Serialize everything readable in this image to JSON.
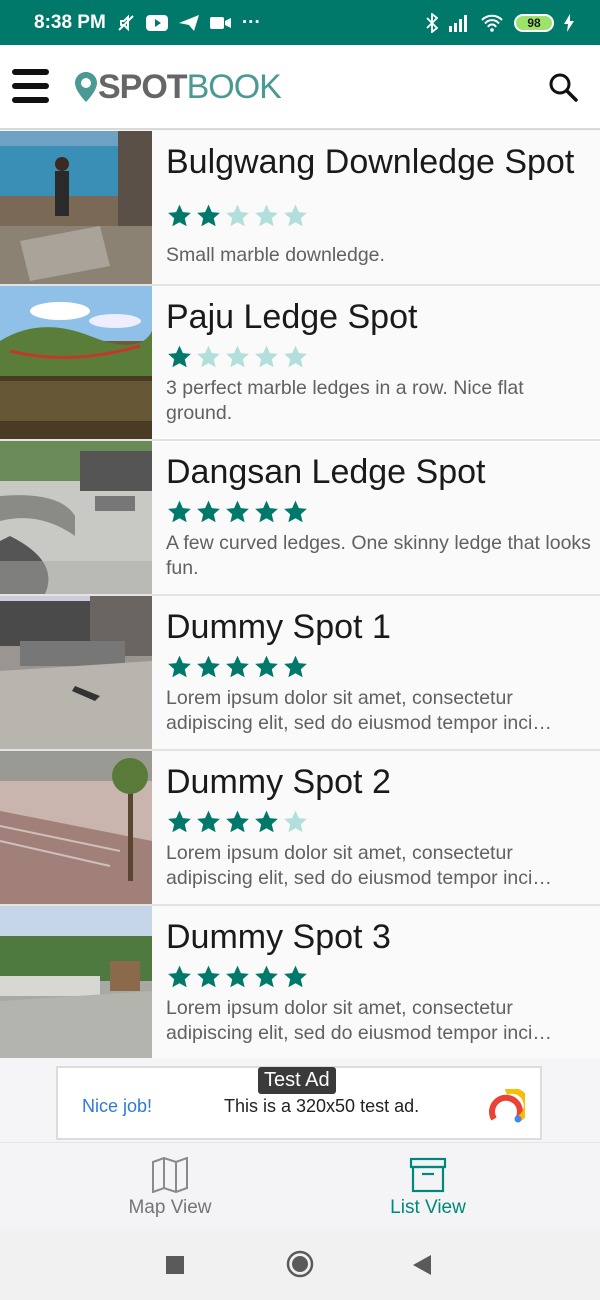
{
  "status": {
    "time": "8:38 PM",
    "battery": "98"
  },
  "app": {
    "logo_spot": "SPOT",
    "logo_book": "BOOK"
  },
  "spots": [
    {
      "title": "Bulgwang Downledge Spot",
      "rating": 2,
      "description": "Small marble downledge."
    },
    {
      "title": "Paju Ledge Spot",
      "rating": 1,
      "description": "3 perfect marble ledges in a row. Nice flat ground."
    },
    {
      "title": "Dangsan Ledge Spot",
      "rating": 5,
      "description": "A few curved ledges. One skinny ledge that looks fun."
    },
    {
      "title": "Dummy Spot 1",
      "rating": 5,
      "description": "Lorem ipsum dolor sit amet, consectetur adipiscing elit, sed do eiusmod tempor inci…"
    },
    {
      "title": "Dummy Spot 2",
      "rating": 4,
      "description": "Lorem ipsum dolor sit amet, consectetur adipiscing elit, sed do eiusmod tempor inci…"
    },
    {
      "title": "Dummy Spot 3",
      "rating": 5,
      "description": "Lorem ipsum dolor sit amet, consectetur adipiscing elit, sed do eiusmod tempor inci…"
    }
  ],
  "ad": {
    "label": "Test Ad",
    "nice": "Nice job!",
    "text": "This is a 320x50 test ad."
  },
  "bottom_nav": {
    "map_label": "Map View",
    "list_label": "List View"
  },
  "colors": {
    "primary": "#00796b",
    "star_filled": "#00796b",
    "star_empty": "#b2dfdb",
    "active_nav": "#00897b",
    "inactive_nav": "#757575"
  },
  "icons": {
    "menu": "hamburger-icon",
    "search": "search-icon",
    "map": "map-icon",
    "list": "archive-box-icon"
  }
}
